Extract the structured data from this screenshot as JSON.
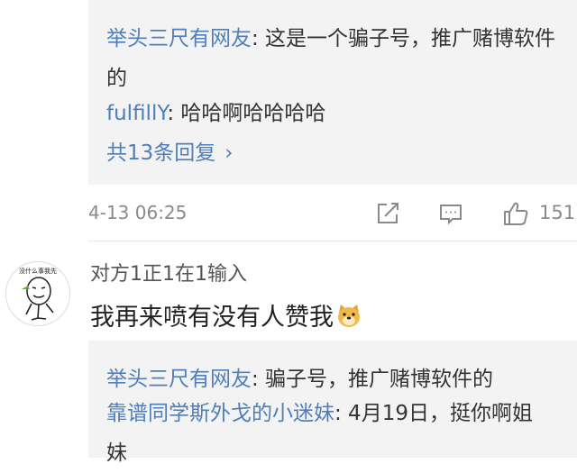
{
  "top_thread": {
    "replies": [
      {
        "user": "举头三尺有网友",
        "text": ": 这是一个骗子号，推广赌博软件的"
      },
      {
        "user": "fulfillY",
        "text": ": 哈哈啊哈哈哈哈"
      }
    ],
    "more_label": "共13条回复",
    "more_chevron": "›"
  },
  "meta": {
    "timestamp": "4-13 06:25",
    "like_count": "151",
    "icons": [
      "share-icon",
      "comment-icon",
      "like-icon"
    ]
  },
  "comment": {
    "avatar_caption": "没什么事我先",
    "username": "对方1正1在1输入",
    "text": "我再来喷有没有人赞我",
    "emoji": "doge-emoji"
  },
  "bottom_thread": {
    "replies": [
      {
        "user": "举头三尺有网友",
        "text": ": 骗子号，推广赌博软件的"
      },
      {
        "user": "靠谱同学斯外戈的小迷妹",
        "text": ": 4月19日，挺你啊姐妹"
      }
    ]
  },
  "colors": {
    "link": "#4f7eb8",
    "reply_bg": "#f3f3f3",
    "meta_gray": "#8a8a8a"
  }
}
